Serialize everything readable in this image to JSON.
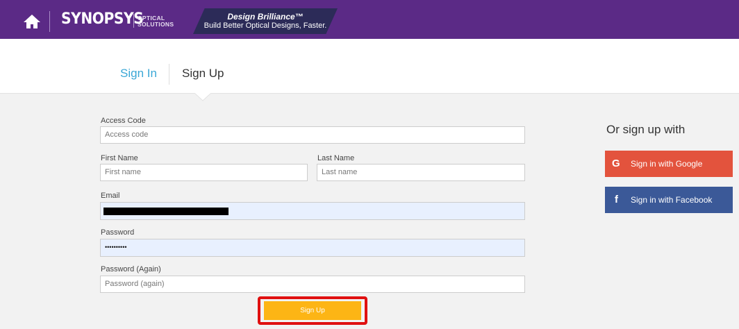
{
  "header": {
    "logo_text": "SYNOPSYS",
    "logo_sub_line1": "OPTICAL",
    "logo_sub_line2": "SOLUTIONS",
    "banner_title": "Design Brilliance™",
    "banner_subtitle": "Build Better Optical Designs, Faster."
  },
  "tabs": {
    "signin": "Sign In",
    "signup": "Sign Up"
  },
  "form": {
    "access_code": {
      "label": "Access Code",
      "placeholder": "Access code"
    },
    "first_name": {
      "label": "First Name",
      "placeholder": "First name"
    },
    "last_name": {
      "label": "Last Name",
      "placeholder": "Last name"
    },
    "email": {
      "label": "Email",
      "value": ""
    },
    "password": {
      "label": "Password",
      "value": "••••••••••"
    },
    "password_again": {
      "label": "Password (Again)",
      "placeholder": "Password (again)"
    },
    "submit_label": "Sign Up"
  },
  "social": {
    "heading": "Or sign up with",
    "google": {
      "icon": "G",
      "label": "Sign in with Google"
    },
    "facebook": {
      "icon": "f",
      "label": "Sign in with Facebook"
    }
  },
  "colors": {
    "header_bg": "#5b2a86",
    "accent_blue": "#3aa7d6",
    "signup_button": "#fdb515",
    "google": "#e3533d",
    "facebook": "#3b5998"
  }
}
